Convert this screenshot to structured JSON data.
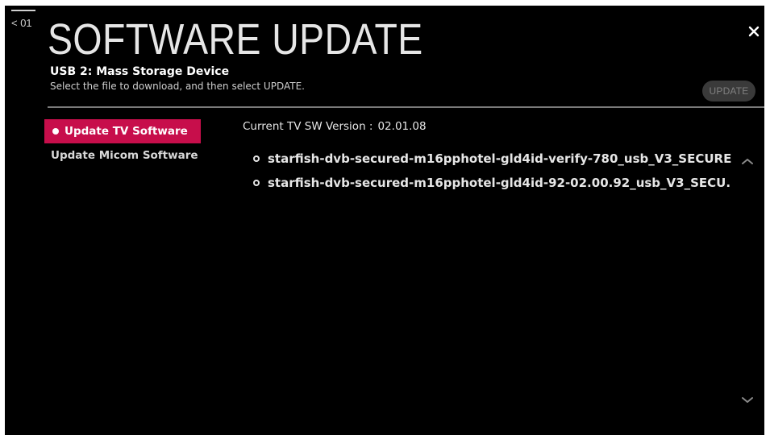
{
  "back": {
    "label": "< 01"
  },
  "title": "SOFTWARE UPDATE",
  "device": {
    "name": "USB 2: Mass Storage Device",
    "instruction": "Select the file to download, and then select UPDATE."
  },
  "update_button": {
    "label": "UPDATE"
  },
  "menu": {
    "items": [
      {
        "label": "Update TV Software",
        "selected": true
      },
      {
        "label": "Update Micom Software",
        "selected": false
      }
    ]
  },
  "current_version": {
    "label": "Current TV SW Version :",
    "value": "02.01.08"
  },
  "files": [
    {
      "name": "starfish-dvb-secured-m16pphotel-gld4id-verify-780_usb_V3_SECURE..."
    },
    {
      "name": "starfish-dvb-secured-m16pphotel-gld4id-92-02.00.92_usb_V3_SECU..."
    }
  ],
  "icons": {
    "close": "close-icon",
    "scroll_up": "chevron-up-icon",
    "scroll_down": "chevron-down-icon"
  },
  "colors": {
    "background": "#000000",
    "accent": "#c70e4b",
    "text": "#e6e6e6",
    "disabled_button": "#3a3a3a"
  }
}
